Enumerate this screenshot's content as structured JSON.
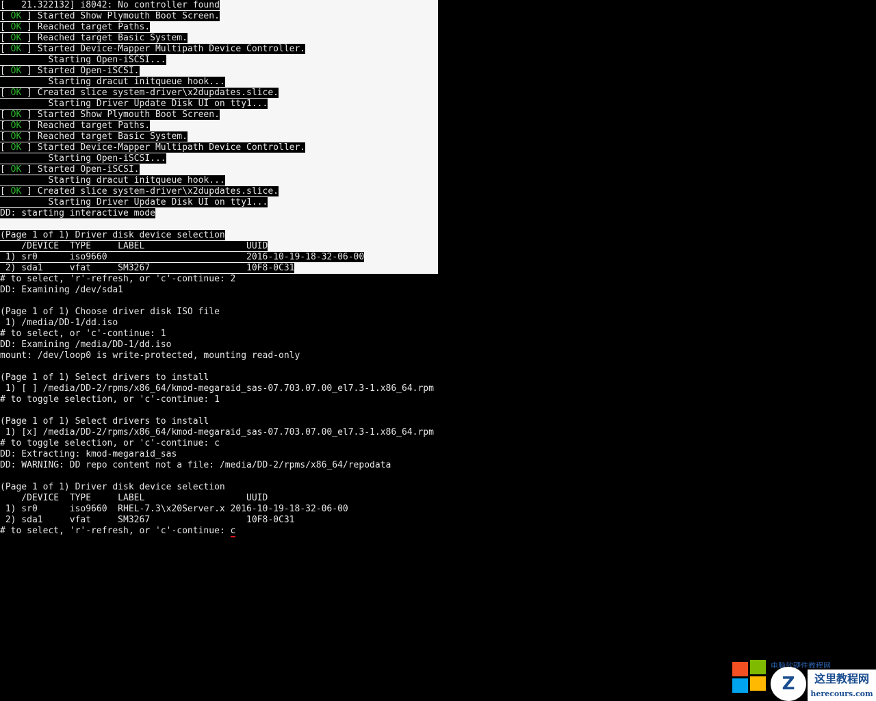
{
  "colors": {
    "background": "#000000",
    "panel": "#f6f6f6",
    "text": "#e6e6e6",
    "ok": "#2fb82f",
    "cursor_underline": "#e0141e"
  },
  "boot_log": [
    {
      "kind": "kernel",
      "text": "[   21.322132] i8042: No controller found"
    },
    {
      "kind": "ok",
      "prefix": "[ ",
      "status": "OK",
      "suffix": " ] Started Show Plymouth Boot Screen."
    },
    {
      "kind": "ok",
      "prefix": "[ ",
      "status": "OK",
      "suffix": " ] Reached target Paths."
    },
    {
      "kind": "ok",
      "prefix": "[ ",
      "status": "OK",
      "suffix": " ] Reached target Basic System."
    },
    {
      "kind": "ok",
      "prefix": "[ ",
      "status": "OK",
      "suffix": " ] Started Device-Mapper Multipath Device Controller."
    },
    {
      "kind": "plain",
      "text": "         Starting Open-iSCSI..."
    },
    {
      "kind": "ok",
      "prefix": "[ ",
      "status": "OK",
      "suffix": " ] Started Open-iSCSI."
    },
    {
      "kind": "plain",
      "text": "         Starting dracut initqueue hook..."
    },
    {
      "kind": "ok",
      "prefix": "[ ",
      "status": "OK",
      "suffix": " ] Created slice system-driver\\x2dupdates.slice."
    },
    {
      "kind": "plain",
      "text": "         Starting Driver Update Disk UI on tty1..."
    },
    {
      "kind": "ok",
      "prefix": "[ ",
      "status": "OK",
      "suffix": " ] Started Show Plymouth Boot Screen."
    },
    {
      "kind": "ok",
      "prefix": "[ ",
      "status": "OK",
      "suffix": " ] Reached target Paths."
    },
    {
      "kind": "ok",
      "prefix": "[ ",
      "status": "OK",
      "suffix": " ] Reached target Basic System."
    },
    {
      "kind": "ok",
      "prefix": "[ ",
      "status": "OK",
      "suffix": " ] Started Device-Mapper Multipath Device Controller."
    },
    {
      "kind": "plain",
      "text": "         Starting Open-iSCSI..."
    },
    {
      "kind": "ok",
      "prefix": "[ ",
      "status": "OK",
      "suffix": " ] Started Open-iSCSI."
    },
    {
      "kind": "plain",
      "text": "         Starting dracut initqueue hook..."
    },
    {
      "kind": "ok",
      "prefix": "[ ",
      "status": "OK",
      "suffix": " ] Created slice system-driver\\x2dupdates.slice."
    },
    {
      "kind": "plain",
      "text": "         Starting Driver Update Disk UI on tty1..."
    },
    {
      "kind": "plain",
      "text": "DD: starting interactive mode"
    },
    {
      "kind": "blank",
      "text": ""
    },
    {
      "kind": "plain",
      "text": "(Page 1 of 1) Driver disk device selection"
    },
    {
      "kind": "plain",
      "text": "    /DEVICE  TYPE     LABEL                   UUID"
    },
    {
      "kind": "plain",
      "text": " 1) sr0      iso9660                          2016-10-19-18-32-06-00"
    },
    {
      "kind": "plain",
      "text": " 2) sda1     vfat     SM3267                  10F8-0C31"
    }
  ],
  "dialog": [
    "# to select, 'r'-refresh, or 'c'-continue: 2",
    "DD: Examining /dev/sda1",
    "",
    "(Page 1 of 1) Choose driver disk ISO file",
    " 1) /media/DD-1/dd.iso",
    "# to select, or 'c'-continue: 1",
    "DD: Examining /media/DD-1/dd.iso",
    "mount: /dev/loop0 is write-protected, mounting read-only",
    "",
    "(Page 1 of 1) Select drivers to install",
    " 1) [ ] /media/DD-2/rpms/x86_64/kmod-megaraid_sas-07.703.07.00_el7.3-1.x86_64.rpm",
    "# to toggle selection, or 'c'-continue: 1",
    "",
    "(Page 1 of 1) Select drivers to install",
    " 1) [x] /media/DD-2/rpms/x86_64/kmod-megaraid_sas-07.703.07.00_el7.3-1.x86_64.rpm",
    "# to toggle selection, or 'c'-continue: c",
    "DD: Extracting: kmod-megaraid_sas",
    "DD: WARNING: DD repo content not a file: /media/DD-2/rpms/x86_64/repodata",
    "",
    "(Page 1 of 1) Driver disk device selection",
    "    /DEVICE  TYPE     LABEL                   UUID",
    " 1) sr0      iso9660  RHEL-7.3\\x20Server.x 2016-10-19-18-32-06-00",
    " 2) sda1     vfat     SM3267                  10F8-0C31"
  ],
  "prompt": {
    "text": "# to select, 'r'-refresh, or 'c'-continue: ",
    "input_value": "c"
  },
  "watermark": {
    "faint_text": "电脑软硬件教程网",
    "title": "这里教程网",
    "url": "herecours.com",
    "mark": "Z"
  }
}
